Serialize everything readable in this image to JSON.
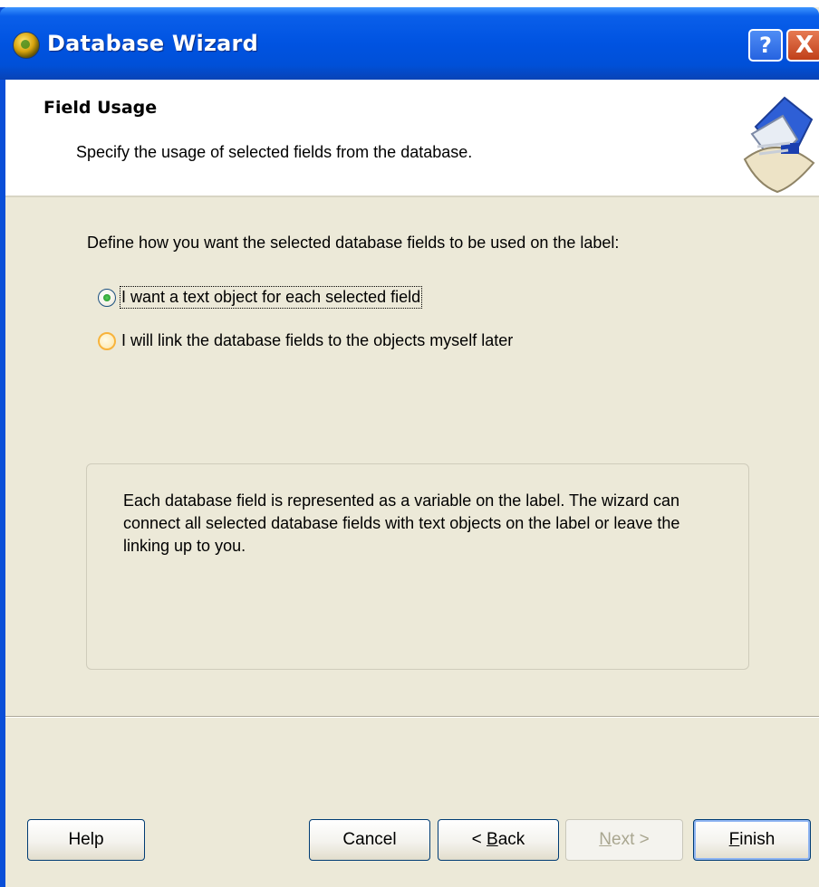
{
  "window": {
    "title": "Database Wizard",
    "help_glyph": "?",
    "close_glyph": "X",
    "accent_color": "#0053E1"
  },
  "header": {
    "title": "Field Usage",
    "subtitle": "Specify the usage of selected fields from the database.",
    "graphic_icon": "database-wizard-graphic"
  },
  "content": {
    "instruction": "Define how you want the selected database fields to be used on the label:",
    "options": [
      {
        "label": "I want a text object for each selected field",
        "selected": true
      },
      {
        "label": "I will link the database fields to the objects myself later",
        "selected": false
      }
    ],
    "description": "Each database field is represented as a variable on the label. The wizard can connect all selected database fields with text objects on the label or leave the linking up to you."
  },
  "footer": {
    "help_label": "Help",
    "cancel_label": "Cancel",
    "back_prefix": "< ",
    "back_mnemonic": "B",
    "back_rest": "ack",
    "next_mnemonic": "N",
    "next_rest": "ext >",
    "finish_mnemonic": "F",
    "finish_rest": "inish"
  }
}
